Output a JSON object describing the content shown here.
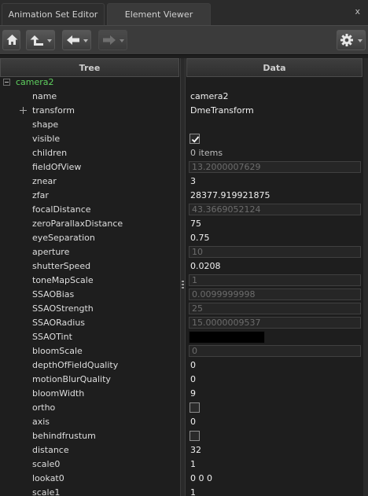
{
  "tabs": [
    "Animation Set Editor",
    "Element Viewer"
  ],
  "close_symbol": "x",
  "icons": {
    "home": "home-icon",
    "up": "up-arrow-icon",
    "back": "back-arrow-icon",
    "forward": "forward-arrow-icon",
    "settings": "gear-icon"
  },
  "columns": {
    "tree": "Tree",
    "data": "Data"
  },
  "root": "camera2",
  "colors": {
    "root_label": "#5fd05f",
    "background": "#1e1e1e"
  },
  "rows": [
    {
      "name": "name",
      "kind": "text",
      "value": "camera2"
    },
    {
      "name": "transform",
      "kind": "text",
      "value": "DmeTransform",
      "expandable": true
    },
    {
      "name": "shape",
      "kind": "empty"
    },
    {
      "name": "visible",
      "kind": "check",
      "checked": true
    },
    {
      "name": "children",
      "kind": "items",
      "value": "0 items"
    },
    {
      "name": "fieldOfView",
      "kind": "field",
      "value": "13.2000007629"
    },
    {
      "name": "znear",
      "kind": "text",
      "value": "3"
    },
    {
      "name": "zfar",
      "kind": "text",
      "value": "28377.919921875"
    },
    {
      "name": "focalDistance",
      "kind": "field",
      "value": "43.3669052124"
    },
    {
      "name": "zeroParallaxDistance",
      "kind": "text",
      "value": "75"
    },
    {
      "name": "eyeSeparation",
      "kind": "text",
      "value": "0.75"
    },
    {
      "name": "aperture",
      "kind": "field",
      "value": "10"
    },
    {
      "name": "shutterSpeed",
      "kind": "text",
      "value": "0.0208"
    },
    {
      "name": "toneMapScale",
      "kind": "field",
      "value": "1"
    },
    {
      "name": "SSAOBias",
      "kind": "field",
      "value": "0.0099999998"
    },
    {
      "name": "SSAOStrength",
      "kind": "field",
      "value": "25"
    },
    {
      "name": "SSAORadius",
      "kind": "field",
      "value": "15.0000009537"
    },
    {
      "name": "SSAOTint",
      "kind": "color",
      "value": "#000000"
    },
    {
      "name": "bloomScale",
      "kind": "field",
      "value": "0"
    },
    {
      "name": "depthOfFieldQuality",
      "kind": "text",
      "value": "0"
    },
    {
      "name": "motionBlurQuality",
      "kind": "text",
      "value": "0"
    },
    {
      "name": "bloomWidth",
      "kind": "text",
      "value": "9"
    },
    {
      "name": "ortho",
      "kind": "check",
      "checked": false
    },
    {
      "name": "axis",
      "kind": "text",
      "value": "0"
    },
    {
      "name": "behindfrustum",
      "kind": "check",
      "checked": false
    },
    {
      "name": "distance",
      "kind": "text",
      "value": "32"
    },
    {
      "name": "scale0",
      "kind": "text",
      "value": "1"
    },
    {
      "name": "lookat0",
      "kind": "text",
      "value": "0 0 0"
    },
    {
      "name": "scale1",
      "kind": "text",
      "value": "1"
    }
  ]
}
